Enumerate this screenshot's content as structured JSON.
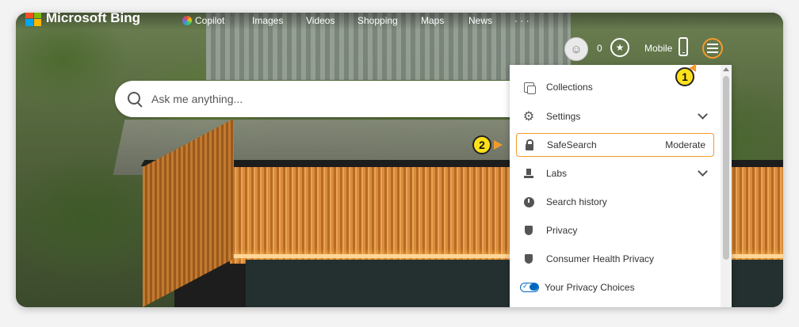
{
  "header": {
    "brand": "Microsoft Bing",
    "nav": [
      {
        "label": "Copilot"
      },
      {
        "label": "Images"
      },
      {
        "label": "Videos"
      },
      {
        "label": "Shopping"
      },
      {
        "label": "Maps"
      },
      {
        "label": "News"
      },
      {
        "label": "· · ·"
      }
    ],
    "points": "0",
    "mobile_label": "Mobile"
  },
  "search": {
    "placeholder": "Ask me anything..."
  },
  "menu": {
    "items": [
      {
        "label": "Collections",
        "icon": "collections-icon"
      },
      {
        "label": "Settings",
        "icon": "gear-icon",
        "expandable": true
      },
      {
        "label": "SafeSearch",
        "icon": "lock-icon",
        "value": "Moderate",
        "highlighted": true
      },
      {
        "label": "Labs",
        "icon": "labs-icon",
        "expandable": true
      },
      {
        "label": "Search history",
        "icon": "clock-icon"
      },
      {
        "label": "Privacy",
        "icon": "shield-icon"
      },
      {
        "label": "Consumer Health Privacy",
        "icon": "shield-icon"
      },
      {
        "label": "Your Privacy Choices",
        "icon": "privacy-toggle-icon"
      }
    ]
  },
  "callouts": [
    {
      "number": "1"
    },
    {
      "number": "2"
    }
  ],
  "colors": {
    "accent": "#f39a2b",
    "callout": "#ffe11a",
    "privacy_blue": "#0067c0"
  }
}
